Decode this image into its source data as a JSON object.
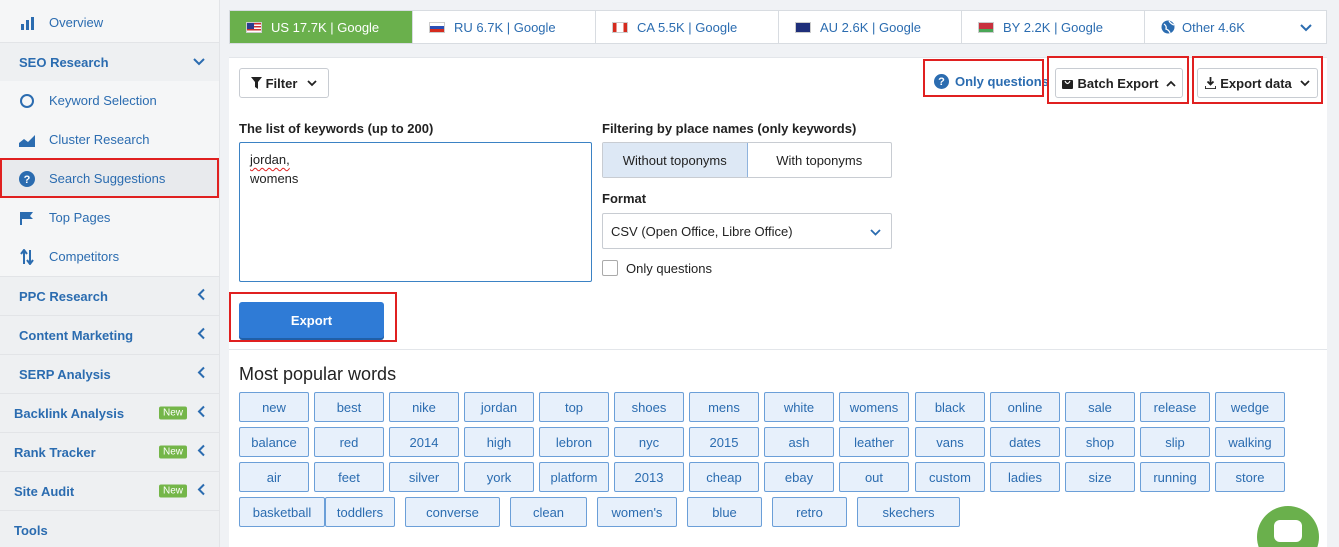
{
  "sidebar": {
    "overview": "Overview",
    "seo_research": "SEO Research",
    "keyword_selection": "Keyword Selection",
    "cluster_research": "Cluster Research",
    "search_suggestions": "Search Suggestions",
    "top_pages": "Top Pages",
    "competitors": "Competitors",
    "ppc_research": "PPC Research",
    "content_marketing": "Content Marketing",
    "serp_analysis": "SERP Analysis",
    "backlink_analysis": "Backlink Analysis",
    "rank_tracker": "Rank Tracker",
    "site_audit": "Site Audit",
    "tools": "Tools",
    "new_badge": "New"
  },
  "tabs": [
    {
      "label": "US 17.7K | Google"
    },
    {
      "label": "RU 6.7K | Google"
    },
    {
      "label": "CA 5.5K | Google"
    },
    {
      "label": "AU 2.6K | Google"
    },
    {
      "label": "BY 2.2K | Google"
    },
    {
      "label": "Other 4.6K"
    }
  ],
  "toolbar": {
    "filter": "Filter",
    "only_questions": "Only questions",
    "batch_export": "Batch Export",
    "export_data": "Export data"
  },
  "form": {
    "keywords_label": "The list of keywords (up to 200)",
    "keywords_line1": "jordan,",
    "keywords_line2": "womens",
    "toponyms_label": "Filtering by place names (only keywords)",
    "without_toponyms": "Without toponyms",
    "with_toponyms": "With toponyms",
    "format_label": "Format",
    "format_value": "CSV (Open Office, Libre Office)",
    "only_questions": "Only questions",
    "export_button": "Export"
  },
  "words": {
    "title": "Most popular words",
    "rows": [
      [
        "new",
        "best",
        "nike",
        "jordan",
        "top",
        "shoes",
        "mens",
        "white",
        "womens",
        "black",
        "online",
        "sale",
        "release",
        "wedge"
      ],
      [
        "balance",
        "red",
        "2014",
        "high",
        "lebron",
        "nyc",
        "2015",
        "ash",
        "leather",
        "vans",
        "dates",
        "shop",
        "slip",
        "walking"
      ],
      [
        "air",
        "feet",
        "silver",
        "york",
        "platform",
        "2013",
        "cheap",
        "ebay",
        "out",
        "custom",
        "ladies",
        "size",
        "running",
        "store"
      ],
      [
        "basketball",
        "toddlers",
        "converse",
        "clean",
        "women's",
        "blue",
        "retro",
        "skechers"
      ]
    ]
  },
  "colors": {
    "accent": "#2b6cb0",
    "active_tab": "#6ab04c",
    "highlight": "#e02020"
  }
}
